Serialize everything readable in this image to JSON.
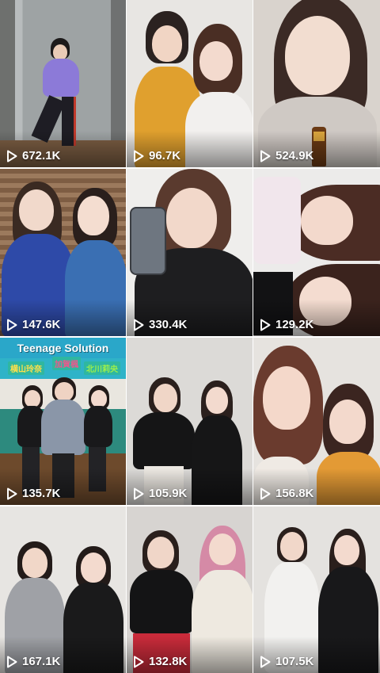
{
  "tiles": [
    {
      "views": "672.1K"
    },
    {
      "views": "96.7K"
    },
    {
      "views": "524.9K"
    },
    {
      "views": "147.6K"
    },
    {
      "views": "330.4K"
    },
    {
      "views": "129.2K"
    },
    {
      "views": "135.7K",
      "overlay": {
        "title": "Teenage Solution",
        "names": [
          "横山玲奈",
          "加賀楓",
          "北川莉央"
        ]
      }
    },
    {
      "views": "105.9K"
    },
    {
      "views": "156.8K"
    },
    {
      "views": "167.1K"
    },
    {
      "views": "132.8K"
    },
    {
      "views": "107.5K"
    }
  ],
  "icons": {
    "play": "play-icon"
  }
}
